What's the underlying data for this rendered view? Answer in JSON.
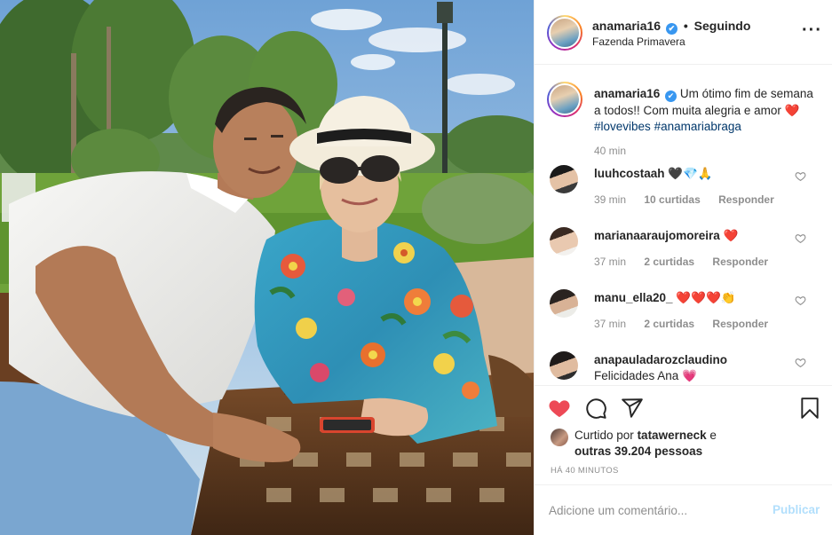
{
  "post": {
    "username": "anamaria16",
    "location": "Fazenda Primavera",
    "follow_status": "Seguindo",
    "separator": "•",
    "verified_mark": "✔"
  },
  "caption": {
    "username": "anamaria16",
    "text": "Um ótimo fim de semana a todos!! Com muita alegria e amor",
    "emoji": "❤️",
    "hashtags": [
      "#lovevibes",
      "#anamariabraga"
    ],
    "time": "40 min"
  },
  "comments": [
    {
      "username": "luuhcostaah",
      "text": "🖤💎🙏",
      "time": "39 min",
      "likes": "10 curtidas",
      "reply": "Responder"
    },
    {
      "username": "marianaaraujomoreira",
      "text": "❤️",
      "time": "37 min",
      "likes": "2 curtidas",
      "reply": "Responder"
    },
    {
      "username": "manu_ella20_",
      "text": "❤️❤️❤️👏",
      "time": "37 min",
      "likes": "2 curtidas",
      "reply": "Responder"
    },
    {
      "username": "anapauladarozclaudino",
      "text": "Felicidades Ana 💗"
    }
  ],
  "likes": {
    "prefix": "Curtido por",
    "liker": "tatawerneck",
    "conjunction": "e",
    "others": "outras 39.204 pessoas"
  },
  "post_time": "HÁ 40 MINUTOS",
  "add_comment": {
    "placeholder": "Adicione um comentário...",
    "publish_label": "Publicar"
  },
  "colors": {
    "liked_heart": "#ed4956",
    "link": "#00376b",
    "verified": "#3897f0",
    "muted": "#8e8e8e",
    "publish_disabled": "#b2dffc"
  },
  "icons": [
    "verified-badge-icon",
    "more-options-icon",
    "heart-filled-icon",
    "comment-icon",
    "share-icon",
    "bookmark-icon",
    "heart-outline-icon"
  ]
}
